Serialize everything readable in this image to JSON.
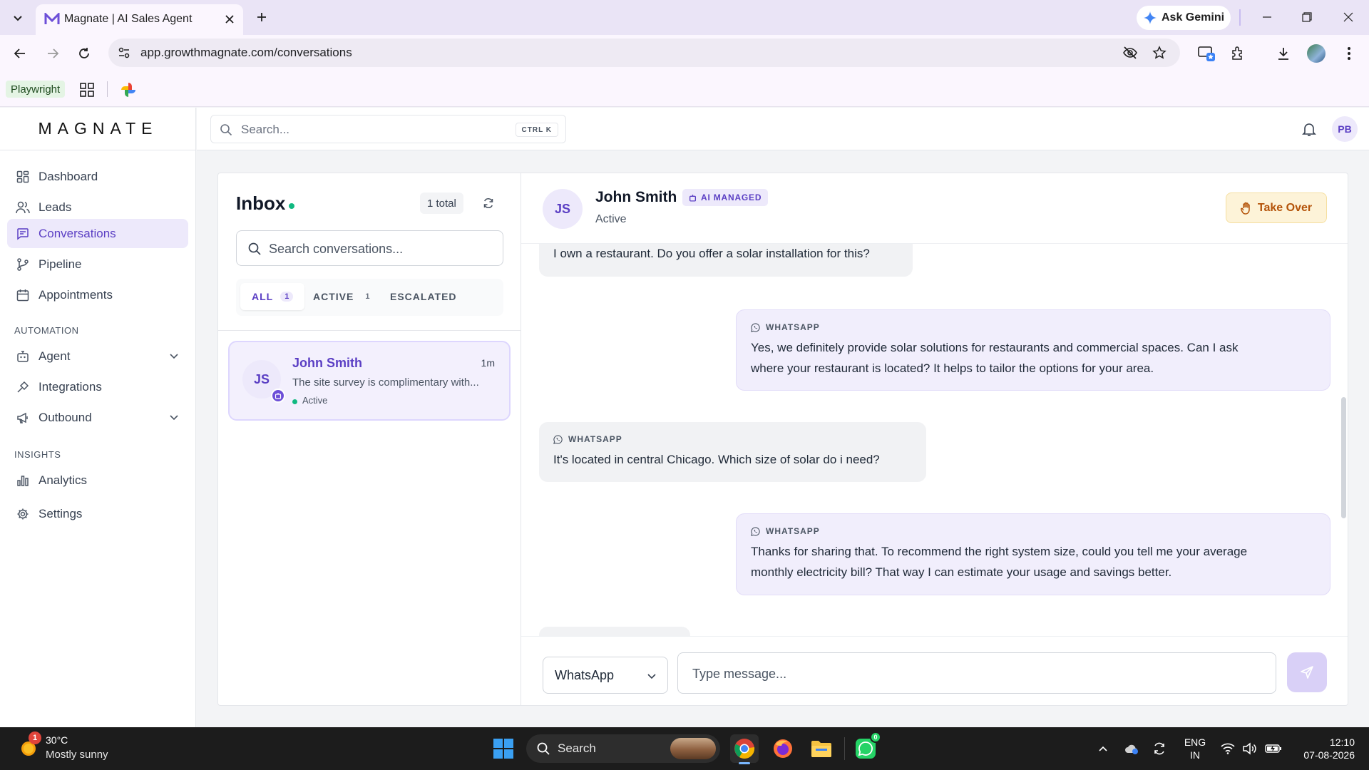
{
  "browser": {
    "tab_title": "Magnate | AI Sales Agent",
    "url": "app.growthmagnate.com/conversations",
    "ask_gemini_label": "Ask Gemini",
    "bookmarks": [
      {
        "label": "Playwright"
      }
    ],
    "colors": {
      "tabbar": "#eae4f6",
      "toolbar": "#fbf6fe"
    }
  },
  "app": {
    "logo_text": "MAGNATE",
    "accent_color": "#5b3fc4",
    "header": {
      "search_placeholder": "Search...",
      "search_shortcut": "CTRL K",
      "user_initials": "PB"
    },
    "nav": {
      "items": [
        {
          "label": "Dashboard",
          "icon": "dashboard-icon"
        },
        {
          "label": "Leads",
          "icon": "users-icon"
        },
        {
          "label": "Conversations",
          "icon": "chat-icon",
          "active": true
        },
        {
          "label": "Pipeline",
          "icon": "branch-icon"
        },
        {
          "label": "Appointments",
          "icon": "calendar-icon"
        }
      ],
      "automation_label": "AUTOMATION",
      "automation_items": [
        {
          "label": "Agent",
          "icon": "bot-icon",
          "expandable": true
        },
        {
          "label": "Integrations",
          "icon": "plug-icon"
        },
        {
          "label": "Outbound",
          "icon": "megaphone-icon",
          "expandable": true
        }
      ],
      "insights_label": "INSIGHTS",
      "insights_items": [
        {
          "label": "Analytics",
          "icon": "bar-chart-icon"
        },
        {
          "label": "Settings",
          "icon": "gear-icon"
        }
      ]
    }
  },
  "inbox": {
    "title": "Inbox",
    "total_label": "1 total",
    "search_placeholder": "Search conversations...",
    "filters": [
      {
        "label": "ALL",
        "count": "1",
        "active": true
      },
      {
        "label": "ACTIVE",
        "count": "1"
      },
      {
        "label": "ESCALATED",
        "count": ""
      }
    ],
    "conversations": [
      {
        "initials": "JS",
        "name": "John Smith",
        "time": "1m",
        "preview": "The site survey is complimentary with...",
        "status": "Active"
      }
    ]
  },
  "chat": {
    "contact_initials": "JS",
    "contact_name": "John Smith",
    "managed_label": "AI MANAGED",
    "contact_status": "Active",
    "takeover_label": "Take Over",
    "messages": [
      {
        "direction": "in",
        "channel": "",
        "text": "I own a restaurant. Do you offer a solar installation for this?"
      },
      {
        "direction": "out",
        "channel": "WHATSAPP",
        "lines": [
          "Yes, we definitely provide solar solutions for restaurants and commercial spaces. Can I ask",
          "where your restaurant is located? It helps to tailor the options for your area."
        ]
      },
      {
        "direction": "in",
        "channel": "WHATSAPP",
        "text": "It's located in central Chicago. Which size of solar do i need?"
      },
      {
        "direction": "out",
        "channel": "WHATSAPP",
        "lines": [
          "Thanks for sharing that. To recommend the right system size, could you tell me your average",
          "monthly electricity bill? That way I can estimate your usage and savings better."
        ]
      }
    ],
    "composer": {
      "channel_value": "WhatsApp",
      "input_placeholder": "Type message..."
    }
  },
  "taskbar": {
    "weather_temp": "30°C",
    "weather_desc": "Mostly sunny",
    "weather_badge": "1",
    "search_label": "Search",
    "whatsapp_badge": "0",
    "lang_line1": "ENG",
    "lang_line2": "IN",
    "time": "12:10",
    "date": "07-08-2026"
  }
}
